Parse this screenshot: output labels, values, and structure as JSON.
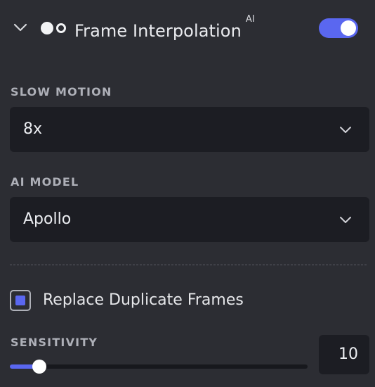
{
  "header": {
    "title": "Frame Interpolation",
    "badge": "AI",
    "expanded": true,
    "enabled": true,
    "collapse_icon": "chevron-down-icon",
    "feature_icon": "frame-interpolation-icon"
  },
  "slow_motion": {
    "label": "SLOW MOTION",
    "value": "8x"
  },
  "ai_model": {
    "label": "AI MODEL",
    "value": "Apollo"
  },
  "replace_duplicates": {
    "label": "Replace Duplicate Frames",
    "checked": true
  },
  "sensitivity": {
    "label": "SENSITIVITY",
    "value": "10",
    "min": 0,
    "max": 100,
    "level": 10
  },
  "colors": {
    "accent": "#5a67f0",
    "background": "#2c2d33",
    "field_background": "#1c1d23",
    "label_text": "#aeb0b8"
  }
}
